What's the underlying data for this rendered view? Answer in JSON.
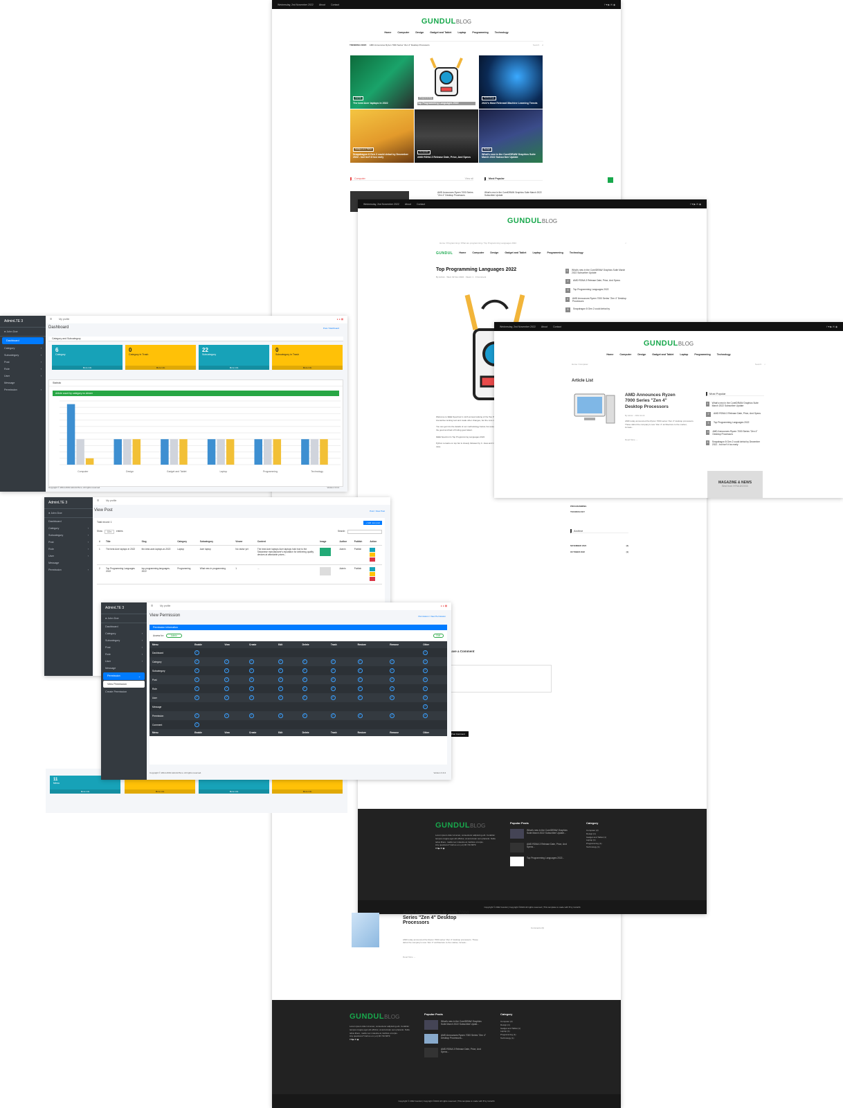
{
  "blog": {
    "date": "Wednesday, 2nd November 2022",
    "links": [
      "About",
      "Contact"
    ],
    "logo_main": "GUNDUL",
    "logo_sub": "BLOG",
    "nav": [
      "Home",
      "Computer",
      "Design",
      "Gadget and Tablet",
      "Laptop",
      "Programming",
      "Technology"
    ],
    "trending_label": "TRENDING NOW:",
    "trending_text": "AMD Announces Ryzen 7000 Series \"Zen 4\" Desktop Processors",
    "search_placeholder": "Search",
    "tiles": [
      {
        "tag": "Laptop",
        "title": "The best Acer laptops in 2022"
      },
      {
        "tag": "Programming",
        "title": "Top Programming Languages 2022"
      },
      {
        "tag": "Technology",
        "title": "2022's Most Relevant Machine Learning Trends"
      },
      {
        "tag": "Gadget and Tablet",
        "title": "Snapdragon 8 Gen 2 could debut by December 2022 - but isn't it too early"
      },
      {
        "tag": "Computer",
        "title": "AMD RDNA 3 Release Date, Price, And Specs"
      },
      {
        "tag": "Design",
        "title": "What's new in the CorelDRAW Graphics Suite March 2022 Subscriber Update"
      }
    ],
    "section_computer": "Computer",
    "view_all": "View all",
    "most_popular": "Most Popular",
    "comp_item": "AMD Announces Ryzen 7000 Series \"Zen 4\" Desktop Processors",
    "pop_item": "What's new in the CorelDRAW Graphics Suite March 2022 Subscriber Update"
  },
  "post": {
    "date": "Wednesday, 2nd November 2022",
    "breadcrumb": "Home / Programming / What are programming / Top Programming Languages 2022",
    "title": "Top Programming Languages 2022",
    "meta": "By Admin · Wed, 02 Nov 2022 · Views: 1 · 0 Comment",
    "popular": [
      "What's new in the CorelDRAW Graphics Suite March 2022 Subscriber Update",
      "AMD RDNA 3 Release Date, Price, And Specs",
      "Top Programming Languages 2022",
      "AMD Announces Ryzen 7000 Series \"Zen 4\" Desktop Processors",
      "Snapdragon 8 Gen 2 could debut by"
    ],
    "body": [
      "Welcome to IEEE Spectrum's ninth annual ranking of the Top Programming Languages! This year we've revamped and streamlined our interactive ranking tool and made other changes, but the core remains the same: the overall popularity of different languages.",
      "You can get into the details of our methodology below, but essentially it mixes a variety of metrics, each weighted differently, to find out the good and bad of finding good talent.",
      "IEEE Spectrum's Top Programming Languages 2022",
      "Python remains on top but is closely followed by C. Java and C++ remain in the top five, with JavaScript slipping down. SQL is a special case."
    ],
    "leave_comment": "Leave a Comment",
    "submit": "Post Comment",
    "comments": "Comments (0)"
  },
  "article_list": {
    "date": "Wednesday, 2nd November 2022",
    "breadcrumb": "Home / Computer",
    "heading": "Article List",
    "item_title": "AMD Announces Ryzen 7000 Series \"Zen 4\" Desktop Processors",
    "item_meta": "By Admin · 2022-11-02",
    "item_excerpt": "AMD today announced the Ryzen 7000 series \"Zen 4\" desktop processors. These debut the company's new \"Zen 4\" architecture to the market, increas...",
    "read_more": "Read More →",
    "most_popular": "Most Popular",
    "popular": [
      "What's new in the CorelDRAW Graphics Suite March 2022 Subscriber Update",
      "AMD RDNA 3 Release Date, Price, And Specs",
      "Top Programming Languages 2022",
      "AMD Announces Ryzen 7000 Series \"Zen 4\" Desktop Processors",
      "Snapdragon 8 Gen 2 could debut by December 2022 - but isn't it too early"
    ],
    "ad_title": "MAGAZINE & NEWS",
    "ad_sub": "Best from HTML5/CSS3",
    "cats": [
      "PROGRAMMING",
      "TECHNOLOGY"
    ],
    "archive": "Archive",
    "archive_items": [
      {
        "m": "NOVEMBER 2022",
        "c": "(4)"
      },
      {
        "m": "OCTOBER 2022",
        "c": "(1)"
      }
    ]
  },
  "footer": {
    "about": "Lorem ipsum dolor sit amet, consectetur adipiscing elit. Curabitur tempus magna eget elit efficitur, at accumsan sem placerat. Nulla tellus libero, mattis nec molestie at, facilisis ut turpis.",
    "questions": "Any questions? Call us on (+1) 96 716 6879",
    "popular_posts": "Popular Posts",
    "category": "Category",
    "posts": [
      "What's new in the CorelDRAW Graphics Suite March 2022 Subscriber Update...",
      "AMD RDNA 3 Release Date, Price, And Specs...",
      "Top Programming Languages 2022..."
    ],
    "posts2": [
      "What's new in the CorelDRAW Graphics Suite March 2022 Subscriber Updat...",
      "AMD Announces Ryzen 7000 Series \"Zen 4\" Desktop Processors...",
      "AMD RDNA 3 Release Date, Price, And Specs..."
    ],
    "cats": [
      "Computer (2)",
      "Design (1)",
      "Gadget and Tablet (1)",
      "Laptop (1)",
      "Programming (1)",
      "Technology (1)"
    ],
    "copyright": "Copyright © 2022 Gundul | Copyright ©2022 All rights reserved | This template is made with ♥ by Colorlib"
  },
  "admin": {
    "brand": "AdminLTE 3",
    "user": "John Doe",
    "profile": "My profile",
    "menu": [
      "Dashboard",
      "Category",
      "Subcategory",
      "Post",
      "Role",
      "User",
      "Message",
      "Permission"
    ],
    "dash_title": "Dashboard",
    "dash_crumb": "Post / Dashboard",
    "cs_title": "Category and Subcategory",
    "cards": [
      {
        "n": "6",
        "l": "Category"
      },
      {
        "n": "0",
        "l": "Category in Trash"
      },
      {
        "n": "22",
        "l": "Subcategory"
      },
      {
        "n": "0",
        "l": "Subcategory in Trash"
      }
    ],
    "more_info": "More info",
    "stat_title": "Statistic",
    "chart_title": "Article count by category vs viewer",
    "dash_copyright": "Copyright © 2014-2019 AdminLTE.io. All rights reserved.",
    "version": "Version 3.0.4",
    "cards2": [
      {
        "n": "11",
        "l": "Menu"
      },
      {
        "n": "",
        "l": "Menu Trash"
      },
      {
        "n": "",
        "l": "Submenu"
      },
      {
        "n": "",
        "l": "Trash"
      }
    ]
  },
  "view_post": {
    "title": "View Post",
    "crumb": "Post / View Post",
    "total": "Total record: 1",
    "add": "+ Add new post",
    "show": "Show",
    "entries": "entries",
    "search": "Search:",
    "headers": [
      "#",
      "Title",
      "Slug",
      "Category",
      "Subcategory",
      "Viewer",
      "Content",
      "Image",
      "Author",
      "Publish",
      "Action"
    ],
    "rows": [
      [
        "1",
        "The best Acer laptops in 2022",
        "the-best-acer-laptops-in-2022",
        "Laptop",
        "Acer laptop",
        "No visitor yet",
        "The best Acer laptops Acer laptops hold true to the Taiwanese manufacturer's reputation for delivering quality devices at affordable prices...",
        "",
        "Admin",
        "Publish"
      ],
      [
        "2",
        "Top Programming Languages 2022",
        "top-programming-languages-2022",
        "Programming",
        "What new in programming",
        "1",
        "...",
        "",
        "Admin",
        "Publish"
      ]
    ]
  },
  "perm": {
    "title": "View Permission",
    "crumb": "Permission / View Permission",
    "box": "Permission Information",
    "access_for": "Access for:",
    "role": "Admin",
    "edit": "Edit",
    "menu_extra": [
      "View Permission",
      "Create Permission"
    ],
    "cols": [
      "Menu",
      "Enable",
      "View",
      "Create",
      "Edit",
      "Delete",
      "Trash",
      "Restore",
      "Remove",
      "Other"
    ],
    "rows": [
      {
        "m": "Dashboard",
        "v": [
          1,
          0,
          0,
          0,
          0,
          0,
          0,
          0,
          1
        ]
      },
      {
        "m": "Category",
        "v": [
          1,
          1,
          1,
          1,
          1,
          1,
          1,
          1,
          1
        ]
      },
      {
        "m": "Subcategory",
        "v": [
          1,
          1,
          1,
          1,
          1,
          1,
          1,
          1,
          1
        ]
      },
      {
        "m": "Post",
        "v": [
          1,
          1,
          1,
          1,
          1,
          1,
          1,
          1,
          1
        ]
      },
      {
        "m": "Role",
        "v": [
          1,
          1,
          1,
          1,
          1,
          1,
          1,
          1,
          1
        ]
      },
      {
        "m": "User",
        "v": [
          1,
          1,
          1,
          1,
          1,
          1,
          1,
          1,
          1
        ]
      },
      {
        "m": "Message",
        "v": [
          0,
          0,
          0,
          0,
          0,
          0,
          0,
          0,
          1
        ]
      },
      {
        "m": "Permission",
        "v": [
          1,
          1,
          1,
          1,
          1,
          1,
          1,
          1,
          1
        ]
      },
      {
        "m": "Comment",
        "v": [
          1,
          0,
          0,
          0,
          0,
          0,
          0,
          0,
          0
        ]
      }
    ],
    "copyright": "Copyright © 2014-2019 AdminLTE.io. All rights reserved.",
    "version": "Version 3.0.4"
  },
  "chart_data": {
    "type": "bar",
    "title": "Article count by category vs viewer",
    "categories": [
      "Computer",
      "Design",
      "Gadget and Tablet",
      "Laptop",
      "Programming",
      "Technology"
    ],
    "series": [
      {
        "name": "",
        "values": [
          9.5,
          4,
          4,
          4,
          4,
          4
        ]
      },
      {
        "name": "",
        "values": [
          4,
          4,
          4,
          4,
          4,
          4
        ]
      },
      {
        "name": "",
        "values": [
          1,
          4,
          4,
          4,
          4,
          4
        ]
      }
    ],
    "colors": [
      "#3d8fd1",
      "#d0d4dc",
      "#f2c036"
    ]
  }
}
